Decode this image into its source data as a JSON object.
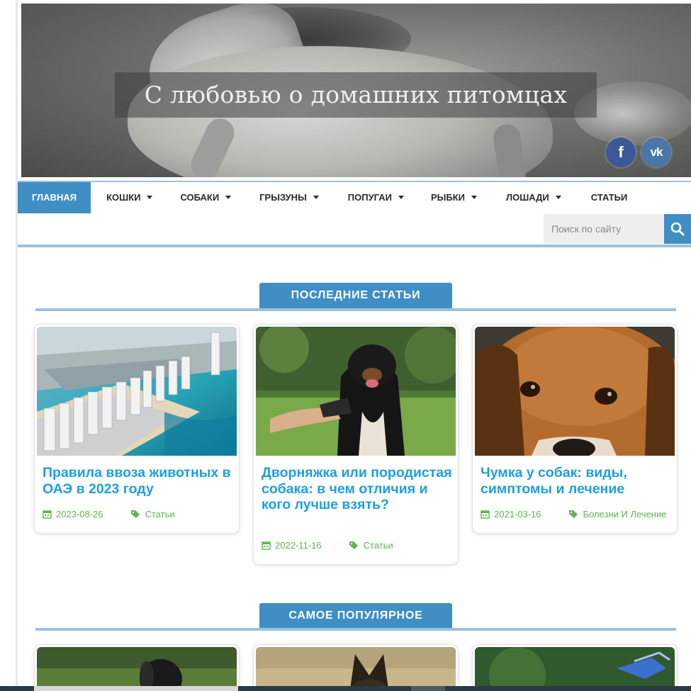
{
  "header": {
    "title": "С любовью о домашних питомцах",
    "social": [
      {
        "name": "facebook",
        "glyph": "f",
        "color": "#3b5998"
      },
      {
        "name": "vkontakte",
        "glyph": "vk",
        "color": "#4a76a8"
      }
    ]
  },
  "nav": {
    "items": [
      {
        "label": "ГЛАВНАЯ",
        "active": true,
        "dropdown": false
      },
      {
        "label": "КОШКИ",
        "active": false,
        "dropdown": true
      },
      {
        "label": "СОБАКИ",
        "active": false,
        "dropdown": true
      },
      {
        "label": "ГРЫЗУНЫ",
        "active": false,
        "dropdown": true
      },
      {
        "label": "ПОПУГАИ",
        "active": false,
        "dropdown": true
      },
      {
        "label": "РЫБКИ",
        "active": false,
        "dropdown": true
      },
      {
        "label": "ЛОШАДИ",
        "active": false,
        "dropdown": true
      },
      {
        "label": "СТАТЬИ",
        "active": false,
        "dropdown": false
      }
    ]
  },
  "search": {
    "placeholder": "Поиск по сайту",
    "value": ""
  },
  "sections": {
    "latest": "ПОСЛЕДНИЕ СТАТЬИ",
    "popular": "САМОЕ ПОПУЛЯРНОЕ"
  },
  "latest_articles": [
    {
      "title": "Правила ввоза животных в ОАЭ в 2023 году",
      "date": "2023-08-26",
      "category": "Статьи",
      "image": "dubai-marina-aerial"
    },
    {
      "title": "Дворняжка или породистая собака: в чем отличия и кого лучше взять?",
      "date": "2022-11-16",
      "category": "Статьи",
      "image": "dog-giving-paw"
    },
    {
      "title": "Чумка у собак: виды, симптомы и лечение",
      "date": "2021-03-16",
      "category": "Болезни И Лечение",
      "image": "sad-beagle-closeup"
    }
  ],
  "popular_articles": [
    {
      "image": "dog-on-grass"
    },
    {
      "image": "shepherd-dog-ears"
    },
    {
      "image": "aquarium-fish"
    }
  ],
  "colors": {
    "accent": "#3f8ec4",
    "link": "#1e9fe0",
    "meta": "#5bb84a",
    "divider": "#9ec2d8"
  }
}
